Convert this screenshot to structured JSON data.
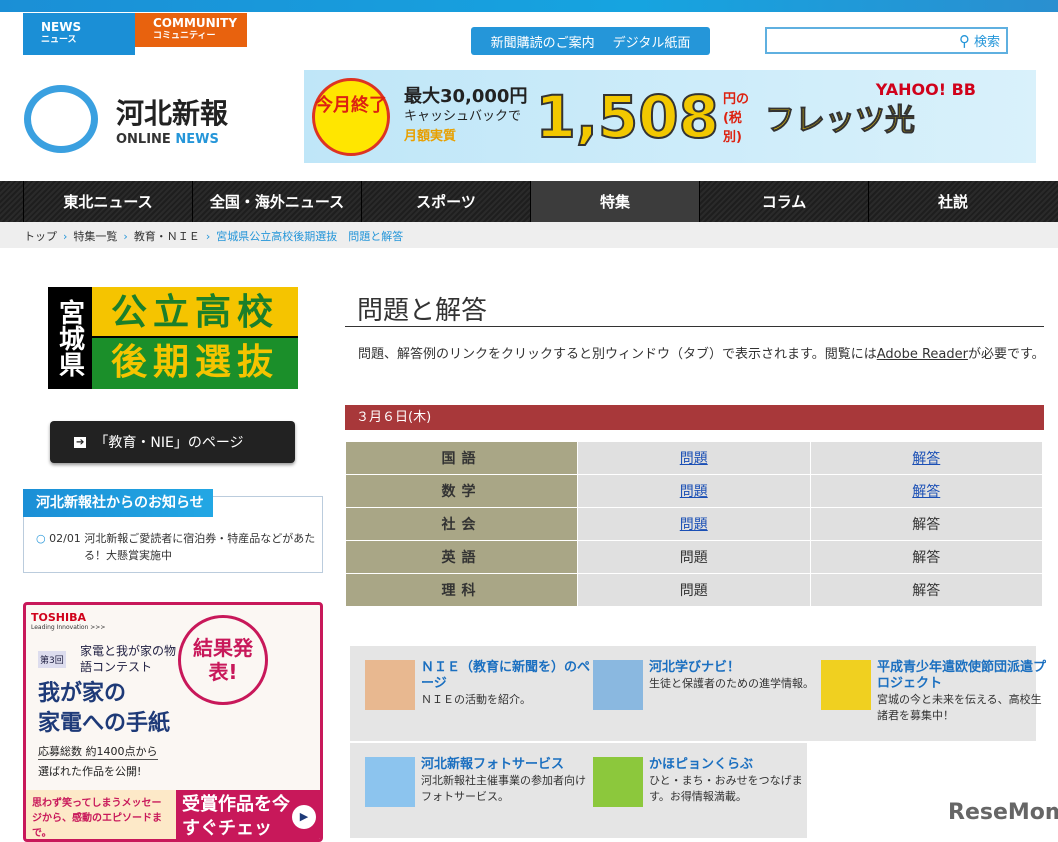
{
  "header": {
    "news_tab": "NEWS",
    "news_tab_sub": "ニュース",
    "community_tab": "COMMUNITY",
    "community_tab_sub": "コミュニティー",
    "subscribe": "新聞購読のご案内",
    "digital": "デジタル紙面",
    "search_button": "検索",
    "logo_title": "河北新報",
    "logo_sub1": "ONLINE",
    "logo_sub2": "NEWS"
  },
  "ad_top": {
    "badge": "今月終了",
    "line1": "最大30,000円",
    "line2": "キャッシュバックで",
    "line3": "月額実質",
    "price": "1,508",
    "unit": "円の(税別)",
    "product": "フレッツ光",
    "brand": "YAHOO! BB"
  },
  "nav": [
    "東北ニュース",
    "全国・海外ニュース",
    "スポーツ",
    "特集",
    "コラム",
    "社説"
  ],
  "breadcrumb": [
    "トップ",
    "特集一覧",
    "教育・ＮＩＥ",
    "宮城県公立高校後期選抜　問題と解答"
  ],
  "sidebar": {
    "banner_left": "宮城県",
    "banner_top": "公立高校",
    "banner_bottom": "後期選抜",
    "nie_button": "「教育・NIE」のページ",
    "notice_title": "河北新報社からのお知らせ",
    "notice_date": "02/01",
    "notice_text": "河北新報ご愛読者に宿泊券・特産品などがあたる！大懸賞実施中"
  },
  "ad_side": {
    "brand": "TOSHIBA",
    "tagline": "Leading Innovation >>>",
    "round": "第3回",
    "contest": "家電と我が家の物語コンテスト",
    "stamp": "結果発表!",
    "headline1": "我が家の",
    "headline2": "家電への手紙",
    "count": "応募総数 約1400点から",
    "count2": "選ばれた作品を公開!",
    "bottom_left": "思わず笑ってしまうメッセージから、感動のエピソードまで。",
    "bottom_right": "受賞作品を今すぐチェック!"
  },
  "main": {
    "title": "問題と解答",
    "intro_before": "　問題、解答例のリンクをクリックすると別ウィンドウ（タブ）で表示されます。閲覧には",
    "intro_link": "Adobe Reader",
    "intro_after": "が必要です。",
    "date": "３月６日(木)",
    "rows": [
      {
        "subject": "国語",
        "q": "問題",
        "a": "解答",
        "q_link": true,
        "a_link": true
      },
      {
        "subject": "数学",
        "q": "問題",
        "a": "解答",
        "q_link": true,
        "a_link": true
      },
      {
        "subject": "社会",
        "q": "問題",
        "a": "解答",
        "q_link": true,
        "a_link": false
      },
      {
        "subject": "英語",
        "q": "問題",
        "a": "解答",
        "q_link": false,
        "a_link": false
      },
      {
        "subject": "理科",
        "q": "問題",
        "a": "解答",
        "q_link": false,
        "a_link": false
      }
    ]
  },
  "links": [
    {
      "title": "ＮＩＥ（教育に新聞を）のページ",
      "desc": "ＮＩＥの活動を紹介。"
    },
    {
      "title": "河北学びナビ！",
      "desc": "生徒と保護者のための進学情報。"
    },
    {
      "title": "平成青少年遣欧使節団派遣プロジェクト",
      "desc": "宮城の今と未来を伝える、高校生諸君を募集中！"
    },
    {
      "title": "河北新報フォトサービス",
      "desc": "河北新報社主催事業の参加者向けフォトサービス。"
    },
    {
      "title": "かほピョンくらぶ",
      "desc": "ひと・まち・おみせをつなげます。お得情報満載。"
    }
  ],
  "watermark": "ReseMom"
}
